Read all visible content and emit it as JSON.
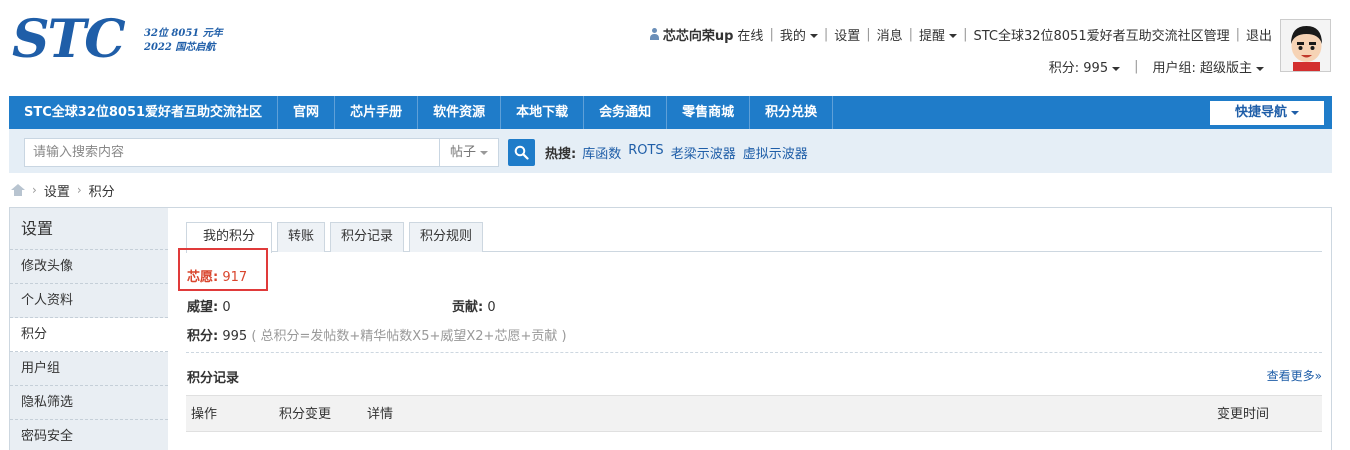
{
  "logo": {
    "text": "STC",
    "tag_line1": "32位 8051 元年",
    "tag_line2": "2022 国芯启航"
  },
  "user_nav": {
    "username": "芯芯向荣up",
    "status": "在线",
    "mine": "我的",
    "settings": "设置",
    "messages": "消息",
    "reminders": "提醒",
    "admin": "STC全球32位8051爱好者互助交流社区管理",
    "logout": "退出",
    "points": "积分: 995",
    "usergroup": "用户组: 超级版主"
  },
  "nav": {
    "items": [
      "STC全球32位8051爱好者互助交流社区",
      "官网",
      "芯片手册",
      "软件资源",
      "本地下载",
      "会务通知",
      "零售商城",
      "积分兑换"
    ],
    "quick_nav": "快捷导航"
  },
  "search": {
    "placeholder": "请输入搜索内容",
    "type": "帖子",
    "hot_label": "热搜:",
    "hot_items": [
      "库函数",
      "ROTS",
      "老梁示波器",
      "虚拟示波器"
    ]
  },
  "breadcrumb": {
    "items": [
      "设置",
      "积分"
    ]
  },
  "sidebar": {
    "title": "设置",
    "items": [
      "修改头像",
      "个人资料",
      "积分",
      "用户组",
      "隐私筛选",
      "密码安全"
    ]
  },
  "tabs": [
    "我的积分",
    "转账",
    "积分记录",
    "积分规则"
  ],
  "credits": {
    "xinyuan_label": "芯愿:",
    "xinyuan_value": "917",
    "weiwang_label": "威望:",
    "weiwang_value": "0",
    "gongxian_label": "贡献:",
    "gongxian_value": "0",
    "total_label": "积分:",
    "total_value": "995",
    "formula": "( 总积分=发帖数+精华帖数X5+威望X2+芯愿+贡献 )"
  },
  "records": {
    "title": "积分记录",
    "more": "查看更多»",
    "columns": [
      "操作",
      "积分变更",
      "详情",
      "变更时间"
    ]
  },
  "colors": {
    "brand_blue": "#1f7cc9",
    "highlight_red": "#e03a3a"
  }
}
